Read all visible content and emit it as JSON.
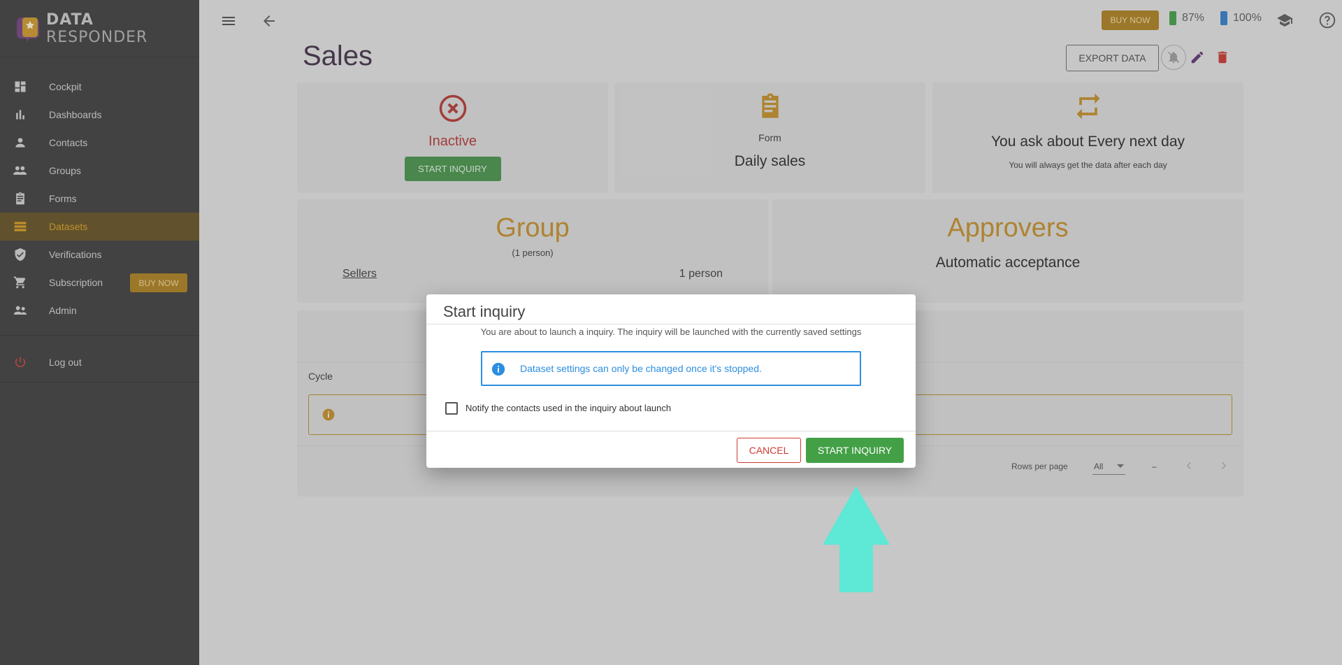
{
  "app": {
    "brand_primary": "DATA",
    "brand_secondary": "RESPONDER"
  },
  "sidebar": {
    "items": [
      {
        "label": "Cockpit",
        "icon": "dashboard-icon"
      },
      {
        "label": "Dashboards",
        "icon": "bar-chart-icon"
      },
      {
        "label": "Contacts",
        "icon": "person-icon"
      },
      {
        "label": "Groups",
        "icon": "people-icon"
      },
      {
        "label": "Forms",
        "icon": "clipboard-icon"
      },
      {
        "label": "Datasets",
        "icon": "list-icon",
        "active": true
      },
      {
        "label": "Verifications",
        "icon": "shield-check-icon"
      },
      {
        "label": "Subscription",
        "icon": "cart-icon"
      },
      {
        "label": "Admin",
        "icon": "admin-people-icon"
      }
    ],
    "buy_now_label": "BUY NOW",
    "logout_label": "Log out"
  },
  "topbar": {
    "buy_now_label": "BUY NOW",
    "battery_1": "87%",
    "battery_2": "100%"
  },
  "page": {
    "title": "Sales",
    "export_label": "EXPORT DATA"
  },
  "cards": {
    "status": {
      "text": "Inactive",
      "button": "START INQUIRY"
    },
    "form": {
      "label": "Form",
      "name": "Daily sales"
    },
    "schedule": {
      "title": "You ask about Every next day",
      "subtitle": "You will always get the data after each day"
    },
    "group": {
      "title": "Group",
      "subtitle": "(1 person)",
      "row_name": "Sellers",
      "row_count": "1 person"
    },
    "approvers": {
      "title": "Approvers",
      "value": "Automatic acceptance"
    }
  },
  "table": {
    "cycle_header": "Cycle",
    "rows_per_page_label": "Rows per page",
    "rows_per_page_value": "All",
    "range": "–"
  },
  "dialog": {
    "title": "Start inquiry",
    "message": "You are about to launch a inquiry. The inquiry will be launched with the currently saved settings",
    "alert": "Dataset settings can only be changed once it's stopped.",
    "checkbox_label": "Notify the contacts used in the inquiry about launch",
    "cancel_label": "CANCEL",
    "start_label": "START INQUIRY"
  },
  "colors": {
    "accent": "#c08920",
    "success": "#43a047",
    "danger": "#d03a34",
    "info": "#2c8ee0",
    "annotation_arrow": "#5ee8d6"
  }
}
